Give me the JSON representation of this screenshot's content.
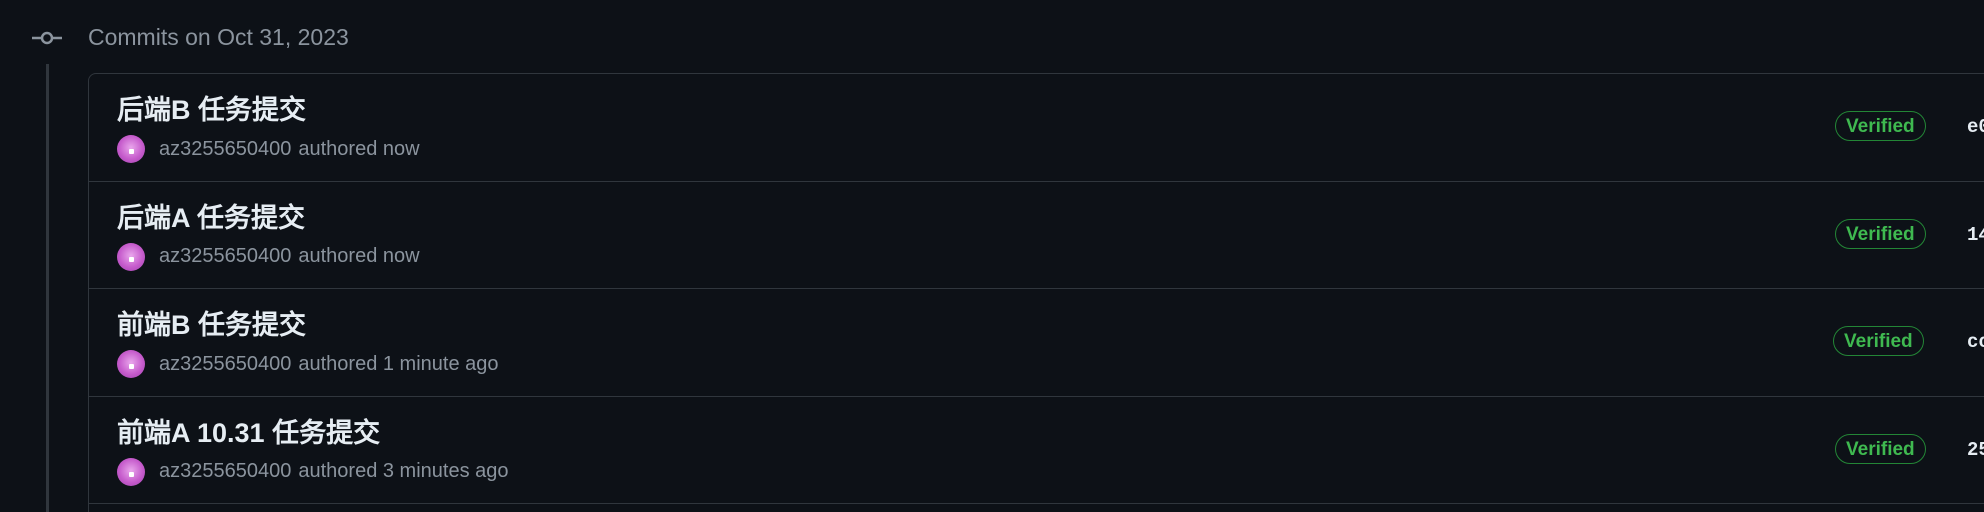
{
  "group": {
    "header": "Commits on Oct 31, 2023",
    "icon": "git-commit-icon"
  },
  "commits": [
    {
      "title": "后端B 任务提交",
      "author": "az3255650400",
      "authored_text": "authored now",
      "badge": "Verified",
      "sha": "e0"
    },
    {
      "title": "后端A 任务提交",
      "author": "az3255650400",
      "authored_text": "authored now",
      "badge": "Verified",
      "sha": "14"
    },
    {
      "title": "前端B 任务提交",
      "author": "az3255650400",
      "authored_text": "authored 1 minute ago",
      "badge": "Verified",
      "sha": "cc"
    },
    {
      "title": "前端A 10.31 任务提交",
      "author": "az3255650400",
      "authored_text": "authored 3 minutes ago",
      "badge": "Verified",
      "sha": "25"
    }
  ],
  "colors": {
    "background": "#0d1117",
    "border": "#30363d",
    "verified_green": "#3fb950",
    "muted_text": "#8b949e",
    "avatar_purple": "#c65ccc"
  }
}
